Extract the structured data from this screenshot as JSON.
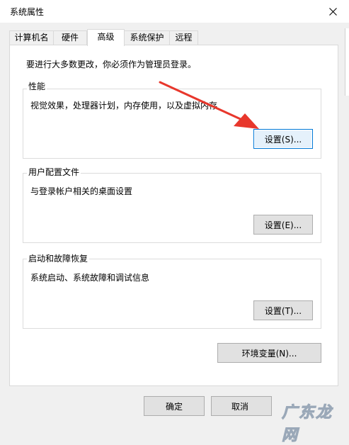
{
  "window": {
    "title": "系统属性"
  },
  "tabs": [
    {
      "label": "计算机名"
    },
    {
      "label": "硬件"
    },
    {
      "label": "高级"
    },
    {
      "label": "系统保护"
    },
    {
      "label": "远程"
    }
  ],
  "active_tab": "高级",
  "intro_text": "要进行大多数更改，你必须作为管理员登录。",
  "groups": {
    "performance": {
      "title": "性能",
      "description": "视觉效果，处理器计划，内存使用，以及虚拟内存",
      "button": "设置(S)..."
    },
    "user_profile": {
      "title": "用户配置文件",
      "description": "与登录帐户相关的桌面设置",
      "button": "设置(E)..."
    },
    "startup_recovery": {
      "title": "启动和故障恢复",
      "description": "系统启动、系统故障和调试信息",
      "button": "设置(T)..."
    }
  },
  "env_button": "环境变量(N)...",
  "footer": {
    "ok": "确定",
    "cancel": "取消"
  },
  "watermark": "广东龙网",
  "colors": {
    "accent": "#0078d7",
    "annotation_arrow": "#e8372c",
    "panel": "#ffffff",
    "window": "#f0f0f0"
  }
}
